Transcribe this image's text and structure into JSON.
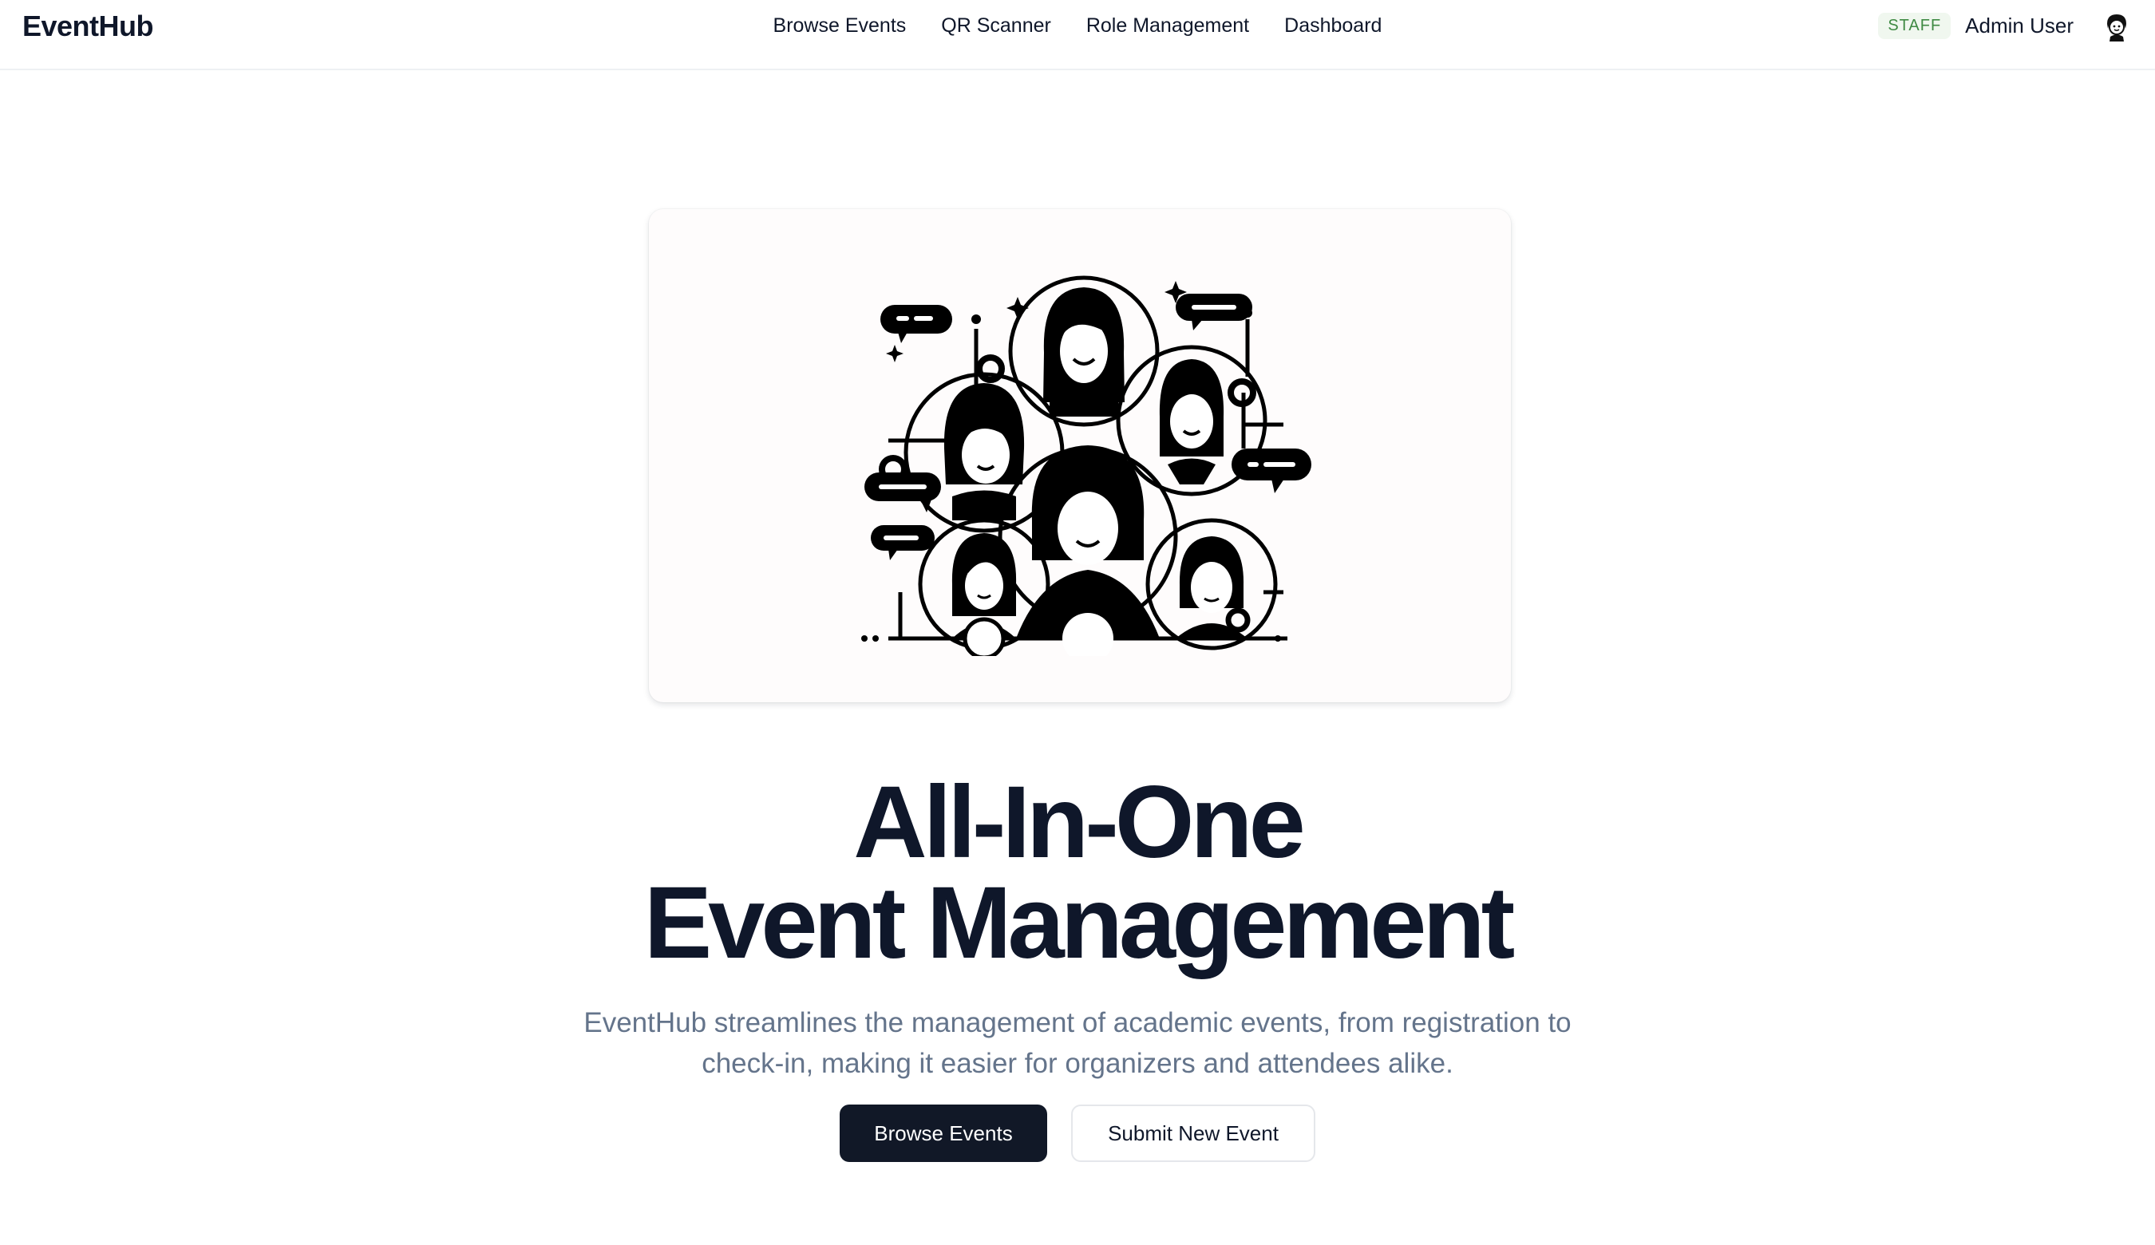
{
  "header": {
    "brand": "EventHub",
    "nav": [
      {
        "label": "Browse Events"
      },
      {
        "label": "QR Scanner"
      },
      {
        "label": "Role Management"
      },
      {
        "label": "Dashboard"
      }
    ],
    "user": {
      "role_badge": "STAFF",
      "name": "Admin User",
      "avatar_icon": "avatar-cartoon-icon"
    }
  },
  "hero": {
    "illustration_icon": "community-people-illustration",
    "headline_line1": "All-In-One",
    "headline_line2": "Event Management",
    "description": "EventHub streamlines the management of academic events, from registration to check-in, making it easier for organizers and attendees alike.",
    "primary_button": "Browse Events",
    "secondary_button": "Submit New Event"
  },
  "colors": {
    "primary": "#111827",
    "text": "#0f172a",
    "muted": "#64748b",
    "badge_bg": "#f0f7ef",
    "badge_text": "#3f8a43"
  }
}
